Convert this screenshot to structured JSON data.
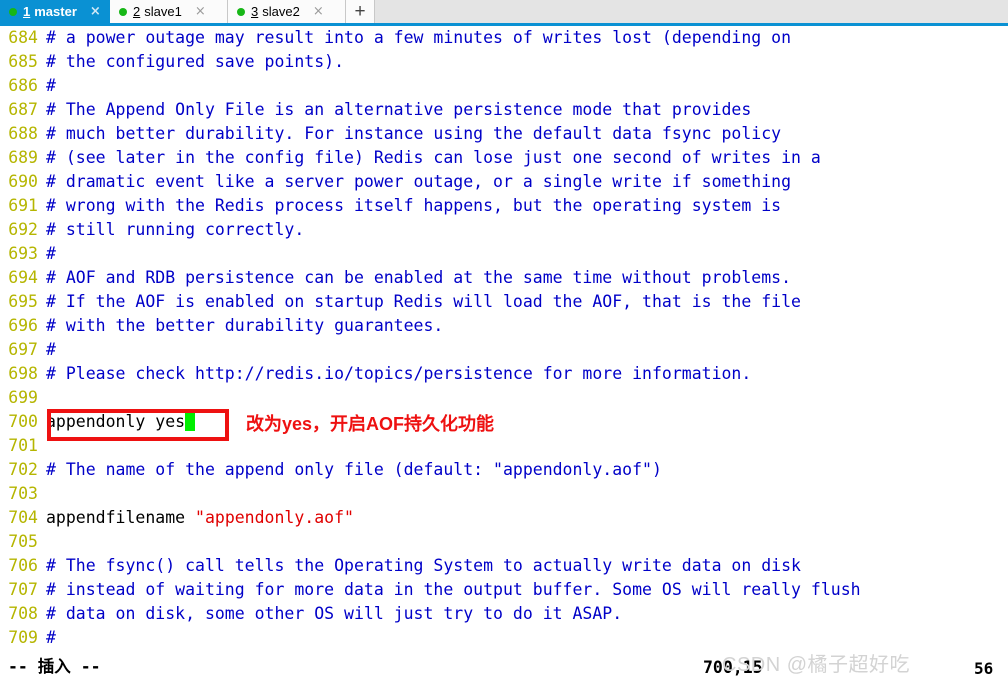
{
  "window": {
    "app": "terminal-tabbed-editor"
  },
  "tabbar": {
    "tabs": [
      {
        "index": "1",
        "label": "master",
        "close": "×",
        "active": true,
        "dot_color": "#17b717"
      },
      {
        "index": "2",
        "label": "slave1",
        "close": "×",
        "active": false,
        "dot_color": "#17b717"
      },
      {
        "index": "3",
        "label": "slave2",
        "close": "×",
        "active": false,
        "dot_color": "#17b717"
      }
    ],
    "add_label": "+",
    "active_bg": "#0a91d3"
  },
  "editor": {
    "file_kind": "redis.conf",
    "lines": [
      {
        "num": "684",
        "text": "# a power outage may result into a few minutes of writes lost (depending on",
        "kind": "comment"
      },
      {
        "num": "685",
        "text": "# the configured save points).",
        "kind": "comment"
      },
      {
        "num": "686",
        "text": "#",
        "kind": "comment"
      },
      {
        "num": "687",
        "text": "# The Append Only File is an alternative persistence mode that provides",
        "kind": "comment"
      },
      {
        "num": "688",
        "text": "# much better durability. For instance using the default data fsync policy",
        "kind": "comment"
      },
      {
        "num": "689",
        "text": "# (see later in the config file) Redis can lose just one second of writes in a",
        "kind": "comment"
      },
      {
        "num": "690",
        "text": "# dramatic event like a server power outage, or a single write if something",
        "kind": "comment"
      },
      {
        "num": "691",
        "text": "# wrong with the Redis process itself happens, but the operating system is",
        "kind": "comment"
      },
      {
        "num": "692",
        "text": "# still running correctly.",
        "kind": "comment"
      },
      {
        "num": "693",
        "text": "#",
        "kind": "comment"
      },
      {
        "num": "694",
        "text": "# AOF and RDB persistence can be enabled at the same time without problems.",
        "kind": "comment"
      },
      {
        "num": "695",
        "text": "# If the AOF is enabled on startup Redis will load the AOF, that is the file",
        "kind": "comment"
      },
      {
        "num": "696",
        "text": "# with the better durability guarantees.",
        "kind": "comment"
      },
      {
        "num": "697",
        "text": "#",
        "kind": "comment"
      },
      {
        "num": "698",
        "text": "# Please check http://redis.io/topics/persistence for more information.",
        "kind": "comment"
      },
      {
        "num": "699",
        "text": "",
        "kind": "blank"
      },
      {
        "num": "700",
        "text": "appendonly yes",
        "kind": "directive",
        "cursor": true
      },
      {
        "num": "701",
        "text": "",
        "kind": "blank"
      },
      {
        "num": "702",
        "text": "# The name of the append only file (default: \"appendonly.aof\")",
        "kind": "comment"
      },
      {
        "num": "703",
        "text": "",
        "kind": "blank"
      },
      {
        "num": "704",
        "key": "appendfilename ",
        "value": "\"appendonly.aof\"",
        "kind": "directive-string"
      },
      {
        "num": "705",
        "text": "",
        "kind": "blank"
      },
      {
        "num": "706",
        "text": "# The fsync() call tells the Operating System to actually write data on disk",
        "kind": "comment"
      },
      {
        "num": "707",
        "text": "# instead of waiting for more data in the output buffer. Some OS will really flush",
        "kind": "comment"
      },
      {
        "num": "708",
        "text": "# data on disk, some other OS will just try to do it ASAP.",
        "kind": "comment"
      },
      {
        "num": "709",
        "text": "#",
        "kind": "comment"
      }
    ],
    "colors": {
      "line_number": "#b5b500",
      "comment": "#0000c8",
      "string": "#e00000",
      "text": "#000000",
      "cursor": "#00ee00"
    }
  },
  "annotation": {
    "box_color": "#ee1111",
    "note": "改为yes，开启AOF持久化功能"
  },
  "status": {
    "mode": "-- 插入 --",
    "position": "700,15",
    "percent": "56"
  },
  "watermark": {
    "text": "CSDN @橘子超好吃"
  }
}
